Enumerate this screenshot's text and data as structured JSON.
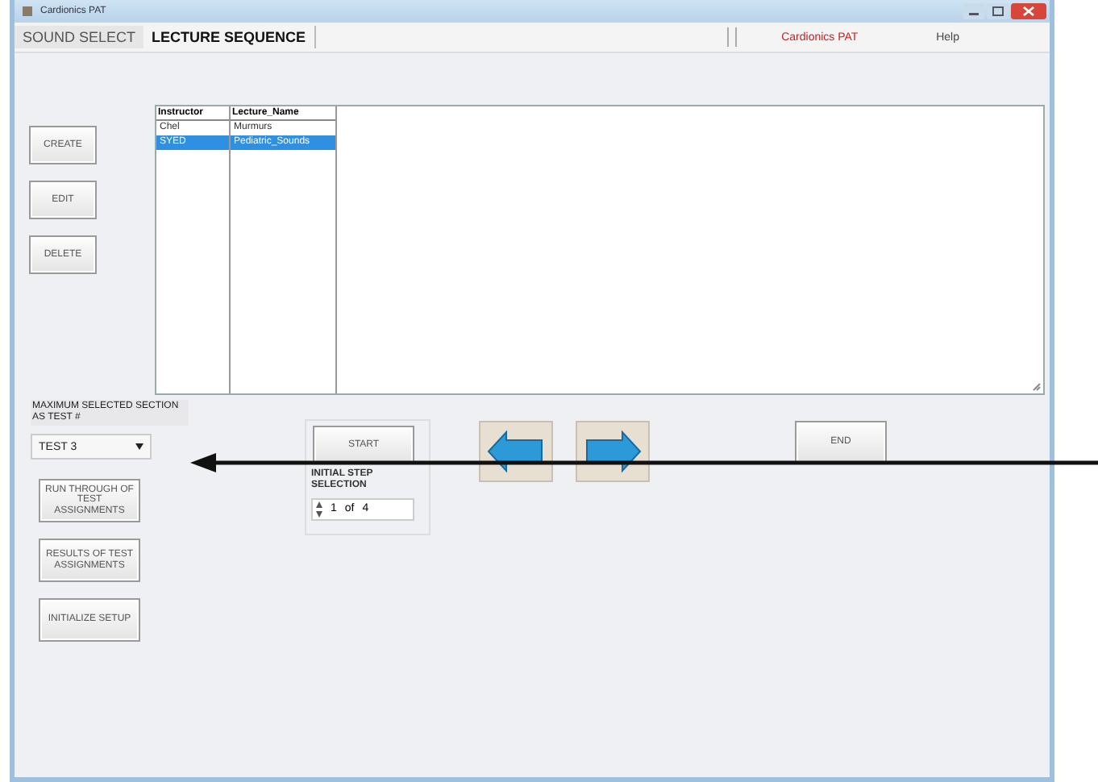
{
  "window": {
    "title": "Cardionics PAT"
  },
  "menu": [
    {
      "label": "SOUND SELECT",
      "selected": false
    },
    {
      "label": "LECTURE SEQUENCE",
      "selected": true
    }
  ],
  "brand": "Cardionics PAT",
  "help": "Help",
  "actions": [
    "CREATE",
    "EDIT",
    "DELETE"
  ],
  "lecture_list": {
    "columns": [
      "Instructor",
      "Lecture_Name"
    ],
    "rows": [
      {
        "cells": [
          "Chel",
          "Murmurs"
        ],
        "selected": false
      },
      {
        "cells": [
          "SYED",
          "Pediatric_Sounds"
        ],
        "selected": true
      }
    ]
  },
  "test_select": {
    "label": "MAXIMUM SELECTED SECTION AS TEST #",
    "value": "TEST 3"
  },
  "test_buttons": [
    "RUN THROUGH OF TEST ASSIGNMENTS",
    "RESULTS OF TEST ASSIGNMENTS",
    "INITIALIZE SETUP"
  ],
  "start": {
    "button": "START",
    "label": "INITIAL STEP SELECTION",
    "step": "1",
    "of": "of",
    "total": "4"
  },
  "end_button": "END"
}
